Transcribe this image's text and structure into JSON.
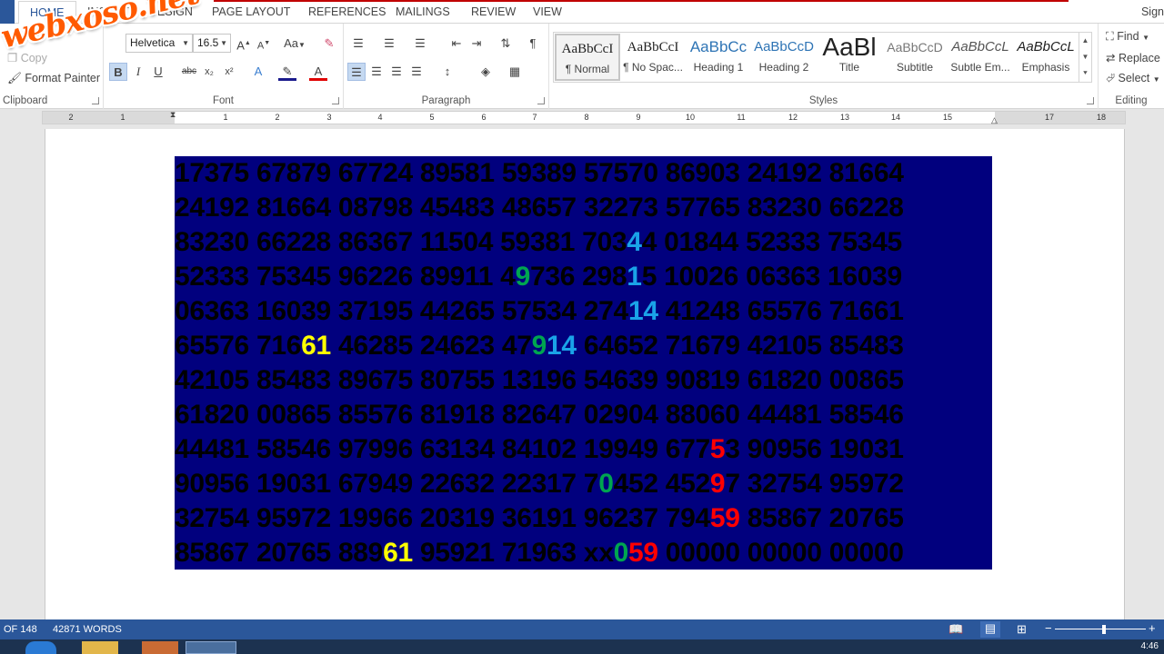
{
  "tabs": {
    "home": "HOME",
    "insert": "INSERT",
    "design": "DESIGN",
    "page_layout": "PAGE LAYOUT",
    "references": "REFERENCES",
    "mailings": "MAILINGS",
    "review": "REVIEW",
    "view": "VIEW",
    "sign_in": "Sign"
  },
  "watermark": "webxoso.net",
  "clipboard": {
    "cut": "Cut",
    "copy": "Copy",
    "format_painter": "Format Painter",
    "label": "Clipboard"
  },
  "font": {
    "name": "Helvetica",
    "size": "16.5",
    "label": "Font",
    "change_case": "Aa",
    "bold": "B",
    "italic": "I",
    "underline": "U",
    "strike": "abc",
    "sub": "x₂",
    "sup": "x²"
  },
  "paragraph": {
    "label": "Paragraph",
    "pilcrow": "¶"
  },
  "styles": {
    "label": "Styles",
    "items": [
      {
        "preview": "AaBbCcI",
        "name": "¶ Normal"
      },
      {
        "preview": "AaBbCcI",
        "name": "¶ No Spac..."
      },
      {
        "preview": "AaBbCc",
        "name": "Heading 1"
      },
      {
        "preview": "AaBbCcD",
        "name": "Heading 2"
      },
      {
        "preview": "AaBl",
        "name": "Title"
      },
      {
        "preview": "AaBbCcD",
        "name": "Subtitle"
      },
      {
        "preview": "AaBbCcL",
        "name": "Subtle Em..."
      },
      {
        "preview": "AaBbCcL",
        "name": "Emphasis"
      }
    ]
  },
  "editing": {
    "find": "Find",
    "replace": "Replace",
    "select": "Select",
    "label": "Editing"
  },
  "ruler": [
    "2",
    "1",
    "1",
    "2",
    "3",
    "4",
    "5",
    "6",
    "7",
    "8",
    "9",
    "10",
    "11",
    "12",
    "13",
    "14",
    "15",
    "17",
    "18"
  ],
  "grid_rows": [
    [
      {
        "t": "17375 67879 67724 89581 59389 57570 86903 24192 81664"
      }
    ],
    [
      {
        "t": "24192 81664 08798 45483 48657 32273 57765 83230 66228"
      }
    ],
    [
      {
        "t": "83230 66228 86367 11504 59381 703"
      },
      {
        "t": "4",
        "c": "hb"
      },
      {
        "t": "4 01844 52333 75345"
      }
    ],
    [
      {
        "t": "52333 75345 96226 89911 4"
      },
      {
        "t": "9",
        "c": "hg"
      },
      {
        "t": "736 298"
      },
      {
        "t": "1",
        "c": "hb"
      },
      {
        "t": "5 10026 06363 16039"
      }
    ],
    [
      {
        "t": "06363 16039 37195 44265 57534 274"
      },
      {
        "t": "14",
        "c": "hb"
      },
      {
        "t": " 41248 65576 71661"
      }
    ],
    [
      {
        "t": "65576 716"
      },
      {
        "t": "61",
        "c": "hy"
      },
      {
        "t": " 46285 24623 47"
      },
      {
        "t": "9",
        "c": "hg"
      },
      {
        "t": "14",
        "c": "hb"
      },
      {
        "t": " 64652 71679 42105 85483"
      }
    ],
    [
      {
        "t": "42105 85483 89675 80755 13196 54639 90819 61820 00865"
      }
    ],
    [
      {
        "t": "61820 00865 85576 81918 82647 02904 88060 44481 58546"
      }
    ],
    [
      {
        "t": "44481 58546 97996 63134 84102 19949 677"
      },
      {
        "t": "5",
        "c": "hr"
      },
      {
        "t": "3 90956 19031"
      }
    ],
    [
      {
        "t": "90956 19031 67949 22632 22317 7"
      },
      {
        "t": "0",
        "c": "hg"
      },
      {
        "t": "452 452"
      },
      {
        "t": "9",
        "c": "hr"
      },
      {
        "t": "7 32754 95972"
      }
    ],
    [
      {
        "t": "32754 95972 19966 20319 36191 96237 794"
      },
      {
        "t": "59",
        "c": "hr"
      },
      {
        "t": " 85867 20765"
      }
    ],
    [
      {
        "t": "85867 20765 889"
      },
      {
        "t": "61",
        "c": "hy"
      },
      {
        "t": " 95921 71963 xx"
      },
      {
        "t": "0",
        "c": "hg"
      },
      {
        "t": "59",
        "c": "hr"
      },
      {
        "t": " 00000 00000 00000"
      }
    ]
  ],
  "status": {
    "page": "OF 148",
    "words": "42871 WORDS"
  },
  "clock": "4:46"
}
